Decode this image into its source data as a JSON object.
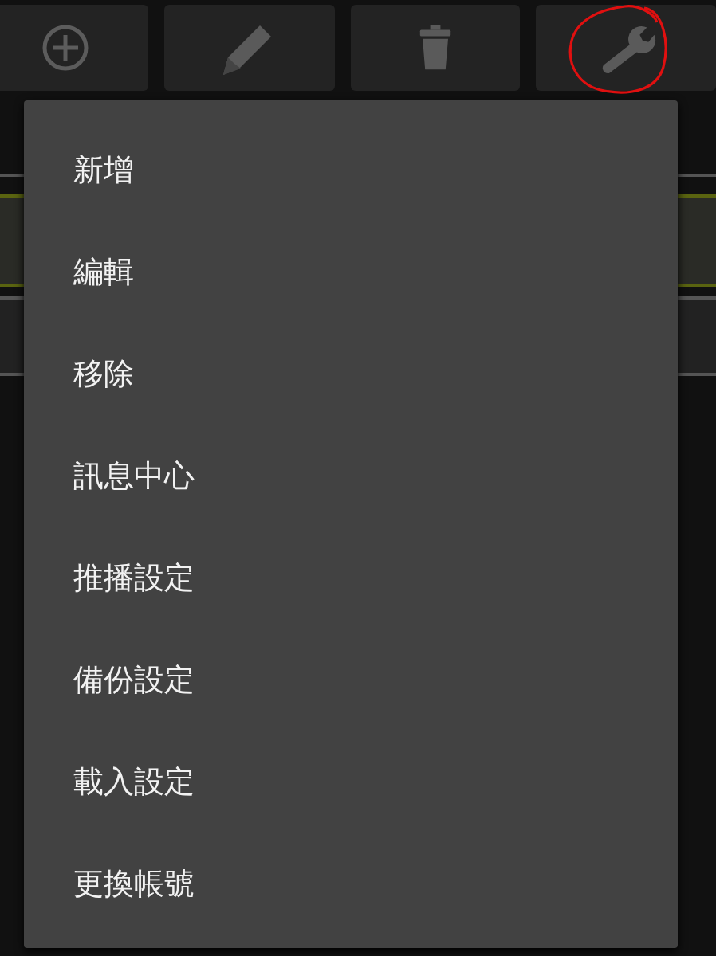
{
  "toolbar": [
    {
      "kind": "add",
      "highlighted": false
    },
    {
      "kind": "edit",
      "highlighted": false
    },
    {
      "kind": "delete",
      "highlighted": false
    },
    {
      "kind": "settings",
      "highlighted": true
    }
  ],
  "menu": {
    "items": [
      {
        "label": "新增"
      },
      {
        "label": "編輯"
      },
      {
        "label": "移除"
      },
      {
        "label": "訊息中心"
      },
      {
        "label": "推播設定"
      },
      {
        "label": "備份設定"
      },
      {
        "label": "載入設定"
      },
      {
        "label": "更換帳號"
      }
    ]
  }
}
